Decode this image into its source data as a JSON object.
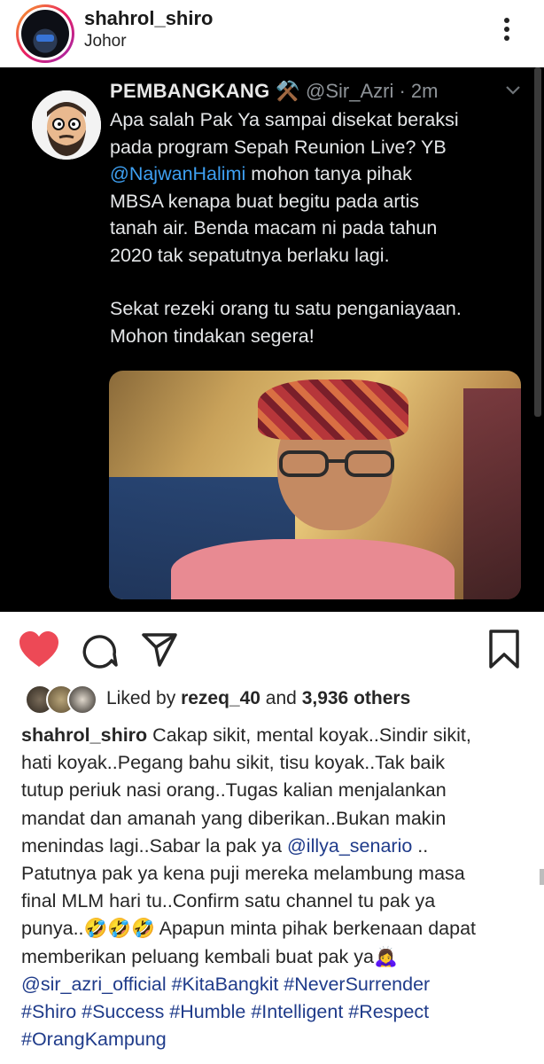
{
  "post": {
    "username": "shahrol_shiro",
    "location": "Johor"
  },
  "tweet": {
    "display_name": "PEMBANGKANG",
    "name_emoji": "⚒️",
    "handle_time": "@Sir_Azri · 2m",
    "line1": "Apa salah Pak Ya sampai disekat beraksi",
    "line2": "pada program Sepah Reunion Live? YB",
    "mention": "@NajwanHalimi",
    "line3_rest": " mohon tanya pihak",
    "line4": "MBSA kenapa buat begitu pada artis",
    "line5": "tanah air. Benda macam ni pada tahun",
    "line6": "2020 tak sepatutnya berlaku lagi.",
    "line7": "Sekat rezeki orang tu satu penganiayaan.",
    "line8": "Mohon tindakan segera!"
  },
  "likes": {
    "prefix": "Liked by ",
    "user": "rezeq_40",
    "middle": " and ",
    "count": "3,936 others"
  },
  "caption": {
    "username": "shahrol_shiro",
    "text_1": " Cakap sikit, mental koyak..Sindir sikit,\nhati koyak..Pegang bahu sikit, tisu koyak..Tak baik\ntutup periuk nasi orang..Tugas kalian menjalankan\nmandat dan amanah yang diberikan..Bukan makin\nmenindas lagi..Sabar la pak ya ",
    "mention_1": "@illya_senario",
    "text_2": " ..\nPatutnya pak ya kena puji mereka melambung masa\nfinal MLM hari tu..Confirm satu channel tu pak ya\npunya..🤣🤣🤣 Apapun minta pihak berkenaan dapat\nmemberikan peluang kembali buat pak ya🙇‍♀️\n",
    "mention_2": "@sir_azri_official",
    "tags_1": " #KitaBangkit #NeverSurrender\n#Shiro #Success #Humble #Intelligent #Respect\n#OrangKampung"
  },
  "colors": {
    "heart": "#ed4956",
    "tweet_bg": "#000000",
    "tweet_link": "#3ea0f2",
    "tag": "#1f3b8a"
  },
  "icons": [
    "heart-icon",
    "comment-icon",
    "share-icon",
    "bookmark-icon",
    "more-icon",
    "chevron-down-icon"
  ]
}
